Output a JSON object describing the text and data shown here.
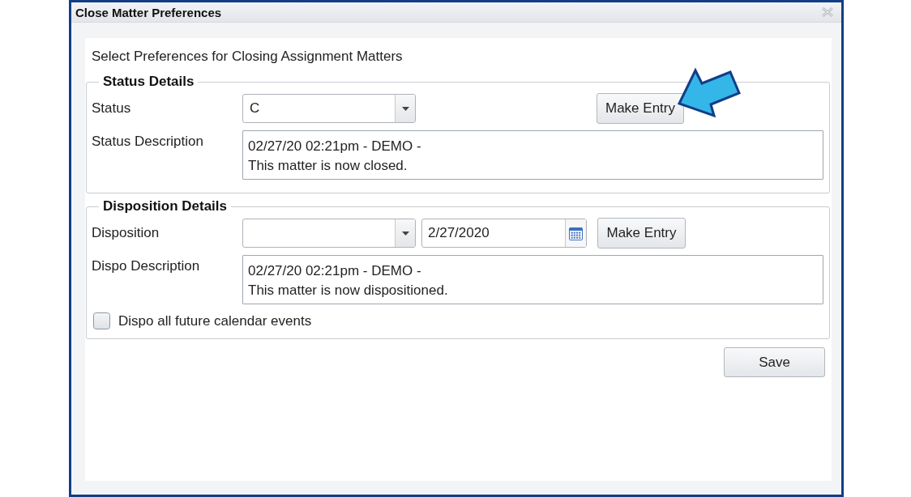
{
  "window": {
    "title": "Close Matter Preferences"
  },
  "instruction": "Select Preferences for Closing Assignment Matters",
  "status_details": {
    "legend": "Status Details",
    "status": {
      "label": "Status",
      "value": "C"
    },
    "make_entry_button": "Make Entry",
    "description": {
      "label": "Status Description",
      "value": "02/27/20 02:21pm - DEMO -\nThis matter is now closed."
    }
  },
  "disposition_details": {
    "legend": "Disposition Details",
    "disposition": {
      "label": "Disposition"
    },
    "date": {
      "value": "2/27/2020"
    },
    "make_entry_button": "Make Entry",
    "description": {
      "label": "Dispo Description",
      "value": "02/27/20 02:21pm - DEMO -\nThis matter is now dispositioned."
    },
    "checkbox": {
      "label": "Dispo all future calendar events",
      "checked": false
    }
  },
  "buttons": [
    "Save"
  ]
}
